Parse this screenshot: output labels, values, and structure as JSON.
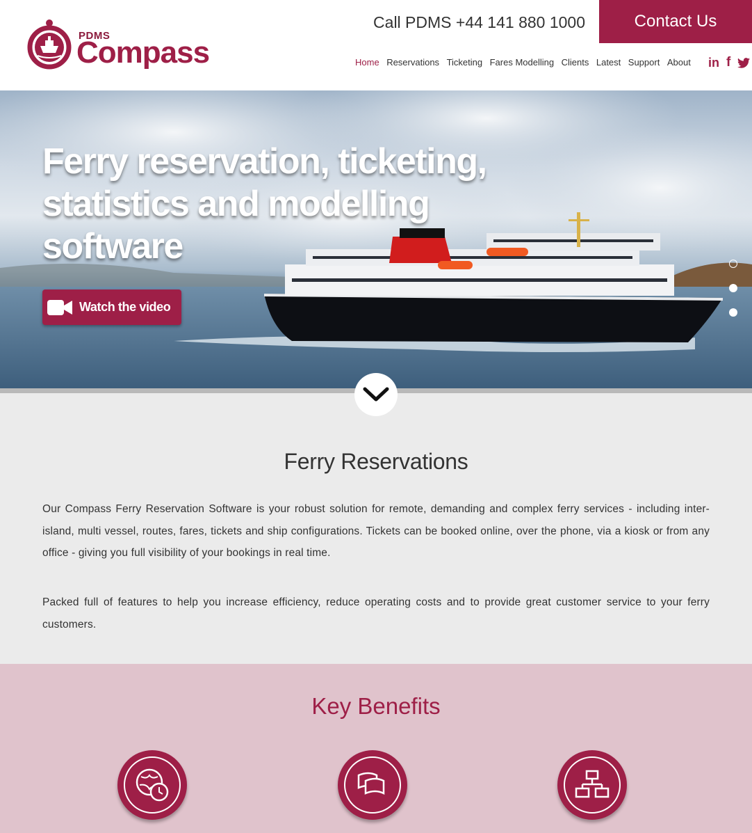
{
  "header": {
    "brand_small": "PDMS",
    "brand_name": "Compass",
    "phone": "Call PDMS +44 141 880 1000",
    "contact_button": "Contact Us",
    "nav": [
      {
        "label": "Home",
        "active": true
      },
      {
        "label": "Reservations"
      },
      {
        "label": "Ticketing"
      },
      {
        "label": "Fares Modelling"
      },
      {
        "label": "Clients"
      },
      {
        "label": "Latest"
      },
      {
        "label": "Support"
      },
      {
        "label": "About"
      }
    ],
    "social": [
      {
        "icon": "linkedin-icon",
        "glyph": "in"
      },
      {
        "icon": "facebook-icon",
        "glyph": "f"
      },
      {
        "icon": "twitter-icon",
        "glyph": "🐦"
      }
    ]
  },
  "hero": {
    "title": "Ferry reservation, ticketing, statistics and modelling software",
    "video_button": "Watch the video",
    "slides": 3,
    "active_slide": 2
  },
  "intro": {
    "title": "Ferry Reservations",
    "para1": "Our Compass Ferry Reservation Software is your robust solution for remote, demanding and complex ferry services - including inter-island, multi vessel, routes, fares, tickets and ship configurations. Tickets can be booked online, over the phone, via a kiosk or from any office - giving you full visibility of your bookings in real time.",
    "para2": "Packed full of features to help you increase efficiency, reduce operating costs and to provide great customer service to your ferry customers."
  },
  "benefits": {
    "title": "Key Benefits",
    "items": [
      {
        "icon": "globe-clock-icon"
      },
      {
        "icon": "tickets-icon"
      },
      {
        "icon": "hierarchy-icon"
      }
    ]
  },
  "colors": {
    "brand": "#9e1f47",
    "section_bg": "#ebebeb",
    "benefits_bg": "#e0c3cc"
  }
}
